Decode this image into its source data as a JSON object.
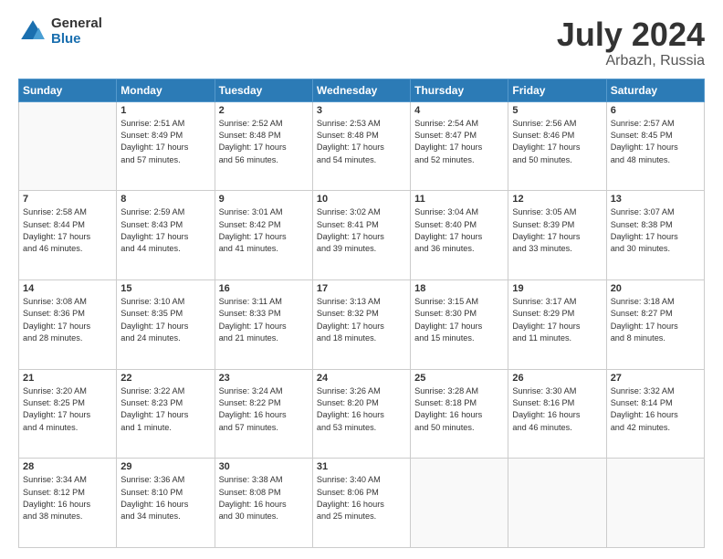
{
  "logo": {
    "general": "General",
    "blue": "Blue"
  },
  "title": {
    "month_year": "July 2024",
    "location": "Arbazh, Russia"
  },
  "header_days": [
    "Sunday",
    "Monday",
    "Tuesday",
    "Wednesday",
    "Thursday",
    "Friday",
    "Saturday"
  ],
  "weeks": [
    [
      {
        "day": "",
        "info": ""
      },
      {
        "day": "1",
        "info": "Sunrise: 2:51 AM\nSunset: 8:49 PM\nDaylight: 17 hours\nand 57 minutes."
      },
      {
        "day": "2",
        "info": "Sunrise: 2:52 AM\nSunset: 8:48 PM\nDaylight: 17 hours\nand 56 minutes."
      },
      {
        "day": "3",
        "info": "Sunrise: 2:53 AM\nSunset: 8:48 PM\nDaylight: 17 hours\nand 54 minutes."
      },
      {
        "day": "4",
        "info": "Sunrise: 2:54 AM\nSunset: 8:47 PM\nDaylight: 17 hours\nand 52 minutes."
      },
      {
        "day": "5",
        "info": "Sunrise: 2:56 AM\nSunset: 8:46 PM\nDaylight: 17 hours\nand 50 minutes."
      },
      {
        "day": "6",
        "info": "Sunrise: 2:57 AM\nSunset: 8:45 PM\nDaylight: 17 hours\nand 48 minutes."
      }
    ],
    [
      {
        "day": "7",
        "info": "Sunrise: 2:58 AM\nSunset: 8:44 PM\nDaylight: 17 hours\nand 46 minutes."
      },
      {
        "day": "8",
        "info": "Sunrise: 2:59 AM\nSunset: 8:43 PM\nDaylight: 17 hours\nand 44 minutes."
      },
      {
        "day": "9",
        "info": "Sunrise: 3:01 AM\nSunset: 8:42 PM\nDaylight: 17 hours\nand 41 minutes."
      },
      {
        "day": "10",
        "info": "Sunrise: 3:02 AM\nSunset: 8:41 PM\nDaylight: 17 hours\nand 39 minutes."
      },
      {
        "day": "11",
        "info": "Sunrise: 3:04 AM\nSunset: 8:40 PM\nDaylight: 17 hours\nand 36 minutes."
      },
      {
        "day": "12",
        "info": "Sunrise: 3:05 AM\nSunset: 8:39 PM\nDaylight: 17 hours\nand 33 minutes."
      },
      {
        "day": "13",
        "info": "Sunrise: 3:07 AM\nSunset: 8:38 PM\nDaylight: 17 hours\nand 30 minutes."
      }
    ],
    [
      {
        "day": "14",
        "info": "Sunrise: 3:08 AM\nSunset: 8:36 PM\nDaylight: 17 hours\nand 28 minutes."
      },
      {
        "day": "15",
        "info": "Sunrise: 3:10 AM\nSunset: 8:35 PM\nDaylight: 17 hours\nand 24 minutes."
      },
      {
        "day": "16",
        "info": "Sunrise: 3:11 AM\nSunset: 8:33 PM\nDaylight: 17 hours\nand 21 minutes."
      },
      {
        "day": "17",
        "info": "Sunrise: 3:13 AM\nSunset: 8:32 PM\nDaylight: 17 hours\nand 18 minutes."
      },
      {
        "day": "18",
        "info": "Sunrise: 3:15 AM\nSunset: 8:30 PM\nDaylight: 17 hours\nand 15 minutes."
      },
      {
        "day": "19",
        "info": "Sunrise: 3:17 AM\nSunset: 8:29 PM\nDaylight: 17 hours\nand 11 minutes."
      },
      {
        "day": "20",
        "info": "Sunrise: 3:18 AM\nSunset: 8:27 PM\nDaylight: 17 hours\nand 8 minutes."
      }
    ],
    [
      {
        "day": "21",
        "info": "Sunrise: 3:20 AM\nSunset: 8:25 PM\nDaylight: 17 hours\nand 4 minutes."
      },
      {
        "day": "22",
        "info": "Sunrise: 3:22 AM\nSunset: 8:23 PM\nDaylight: 17 hours\nand 1 minute."
      },
      {
        "day": "23",
        "info": "Sunrise: 3:24 AM\nSunset: 8:22 PM\nDaylight: 16 hours\nand 57 minutes."
      },
      {
        "day": "24",
        "info": "Sunrise: 3:26 AM\nSunset: 8:20 PM\nDaylight: 16 hours\nand 53 minutes."
      },
      {
        "day": "25",
        "info": "Sunrise: 3:28 AM\nSunset: 8:18 PM\nDaylight: 16 hours\nand 50 minutes."
      },
      {
        "day": "26",
        "info": "Sunrise: 3:30 AM\nSunset: 8:16 PM\nDaylight: 16 hours\nand 46 minutes."
      },
      {
        "day": "27",
        "info": "Sunrise: 3:32 AM\nSunset: 8:14 PM\nDaylight: 16 hours\nand 42 minutes."
      }
    ],
    [
      {
        "day": "28",
        "info": "Sunrise: 3:34 AM\nSunset: 8:12 PM\nDaylight: 16 hours\nand 38 minutes."
      },
      {
        "day": "29",
        "info": "Sunrise: 3:36 AM\nSunset: 8:10 PM\nDaylight: 16 hours\nand 34 minutes."
      },
      {
        "day": "30",
        "info": "Sunrise: 3:38 AM\nSunset: 8:08 PM\nDaylight: 16 hours\nand 30 minutes."
      },
      {
        "day": "31",
        "info": "Sunrise: 3:40 AM\nSunset: 8:06 PM\nDaylight: 16 hours\nand 25 minutes."
      },
      {
        "day": "",
        "info": ""
      },
      {
        "day": "",
        "info": ""
      },
      {
        "day": "",
        "info": ""
      }
    ]
  ]
}
